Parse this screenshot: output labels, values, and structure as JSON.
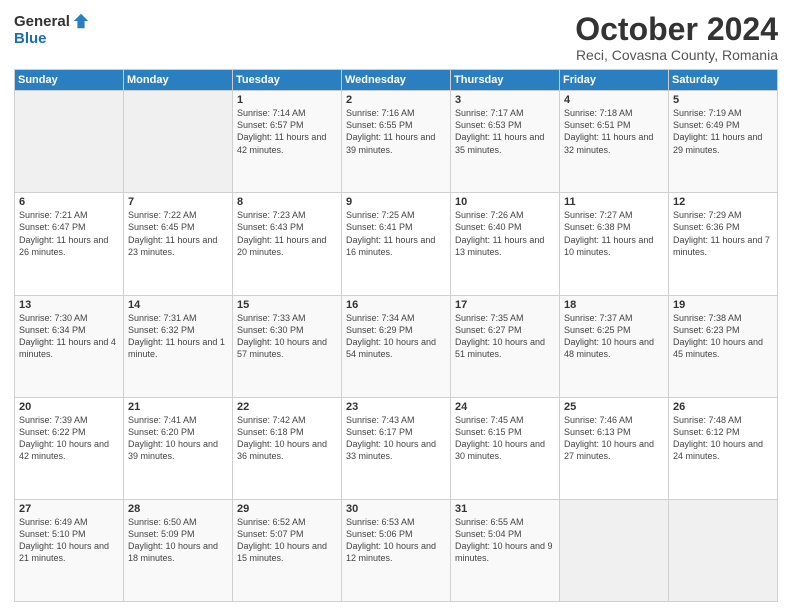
{
  "logo": {
    "general": "General",
    "blue": "Blue"
  },
  "header": {
    "month": "October 2024",
    "location": "Reci, Covasna County, Romania"
  },
  "weekdays": [
    "Sunday",
    "Monday",
    "Tuesday",
    "Wednesday",
    "Thursday",
    "Friday",
    "Saturday"
  ],
  "weeks": [
    [
      {
        "day": "",
        "info": ""
      },
      {
        "day": "",
        "info": ""
      },
      {
        "day": "1",
        "info": "Sunrise: 7:14 AM\nSunset: 6:57 PM\nDaylight: 11 hours and 42 minutes."
      },
      {
        "day": "2",
        "info": "Sunrise: 7:16 AM\nSunset: 6:55 PM\nDaylight: 11 hours and 39 minutes."
      },
      {
        "day": "3",
        "info": "Sunrise: 7:17 AM\nSunset: 6:53 PM\nDaylight: 11 hours and 35 minutes."
      },
      {
        "day": "4",
        "info": "Sunrise: 7:18 AM\nSunset: 6:51 PM\nDaylight: 11 hours and 32 minutes."
      },
      {
        "day": "5",
        "info": "Sunrise: 7:19 AM\nSunset: 6:49 PM\nDaylight: 11 hours and 29 minutes."
      }
    ],
    [
      {
        "day": "6",
        "info": "Sunrise: 7:21 AM\nSunset: 6:47 PM\nDaylight: 11 hours and 26 minutes."
      },
      {
        "day": "7",
        "info": "Sunrise: 7:22 AM\nSunset: 6:45 PM\nDaylight: 11 hours and 23 minutes."
      },
      {
        "day": "8",
        "info": "Sunrise: 7:23 AM\nSunset: 6:43 PM\nDaylight: 11 hours and 20 minutes."
      },
      {
        "day": "9",
        "info": "Sunrise: 7:25 AM\nSunset: 6:41 PM\nDaylight: 11 hours and 16 minutes."
      },
      {
        "day": "10",
        "info": "Sunrise: 7:26 AM\nSunset: 6:40 PM\nDaylight: 11 hours and 13 minutes."
      },
      {
        "day": "11",
        "info": "Sunrise: 7:27 AM\nSunset: 6:38 PM\nDaylight: 11 hours and 10 minutes."
      },
      {
        "day": "12",
        "info": "Sunrise: 7:29 AM\nSunset: 6:36 PM\nDaylight: 11 hours and 7 minutes."
      }
    ],
    [
      {
        "day": "13",
        "info": "Sunrise: 7:30 AM\nSunset: 6:34 PM\nDaylight: 11 hours and 4 minutes."
      },
      {
        "day": "14",
        "info": "Sunrise: 7:31 AM\nSunset: 6:32 PM\nDaylight: 11 hours and 1 minute."
      },
      {
        "day": "15",
        "info": "Sunrise: 7:33 AM\nSunset: 6:30 PM\nDaylight: 10 hours and 57 minutes."
      },
      {
        "day": "16",
        "info": "Sunrise: 7:34 AM\nSunset: 6:29 PM\nDaylight: 10 hours and 54 minutes."
      },
      {
        "day": "17",
        "info": "Sunrise: 7:35 AM\nSunset: 6:27 PM\nDaylight: 10 hours and 51 minutes."
      },
      {
        "day": "18",
        "info": "Sunrise: 7:37 AM\nSunset: 6:25 PM\nDaylight: 10 hours and 48 minutes."
      },
      {
        "day": "19",
        "info": "Sunrise: 7:38 AM\nSunset: 6:23 PM\nDaylight: 10 hours and 45 minutes."
      }
    ],
    [
      {
        "day": "20",
        "info": "Sunrise: 7:39 AM\nSunset: 6:22 PM\nDaylight: 10 hours and 42 minutes."
      },
      {
        "day": "21",
        "info": "Sunrise: 7:41 AM\nSunset: 6:20 PM\nDaylight: 10 hours and 39 minutes."
      },
      {
        "day": "22",
        "info": "Sunrise: 7:42 AM\nSunset: 6:18 PM\nDaylight: 10 hours and 36 minutes."
      },
      {
        "day": "23",
        "info": "Sunrise: 7:43 AM\nSunset: 6:17 PM\nDaylight: 10 hours and 33 minutes."
      },
      {
        "day": "24",
        "info": "Sunrise: 7:45 AM\nSunset: 6:15 PM\nDaylight: 10 hours and 30 minutes."
      },
      {
        "day": "25",
        "info": "Sunrise: 7:46 AM\nSunset: 6:13 PM\nDaylight: 10 hours and 27 minutes."
      },
      {
        "day": "26",
        "info": "Sunrise: 7:48 AM\nSunset: 6:12 PM\nDaylight: 10 hours and 24 minutes."
      }
    ],
    [
      {
        "day": "27",
        "info": "Sunrise: 6:49 AM\nSunset: 5:10 PM\nDaylight: 10 hours and 21 minutes."
      },
      {
        "day": "28",
        "info": "Sunrise: 6:50 AM\nSunset: 5:09 PM\nDaylight: 10 hours and 18 minutes."
      },
      {
        "day": "29",
        "info": "Sunrise: 6:52 AM\nSunset: 5:07 PM\nDaylight: 10 hours and 15 minutes."
      },
      {
        "day": "30",
        "info": "Sunrise: 6:53 AM\nSunset: 5:06 PM\nDaylight: 10 hours and 12 minutes."
      },
      {
        "day": "31",
        "info": "Sunrise: 6:55 AM\nSunset: 5:04 PM\nDaylight: 10 hours and 9 minutes."
      },
      {
        "day": "",
        "info": ""
      },
      {
        "day": "",
        "info": ""
      }
    ]
  ]
}
